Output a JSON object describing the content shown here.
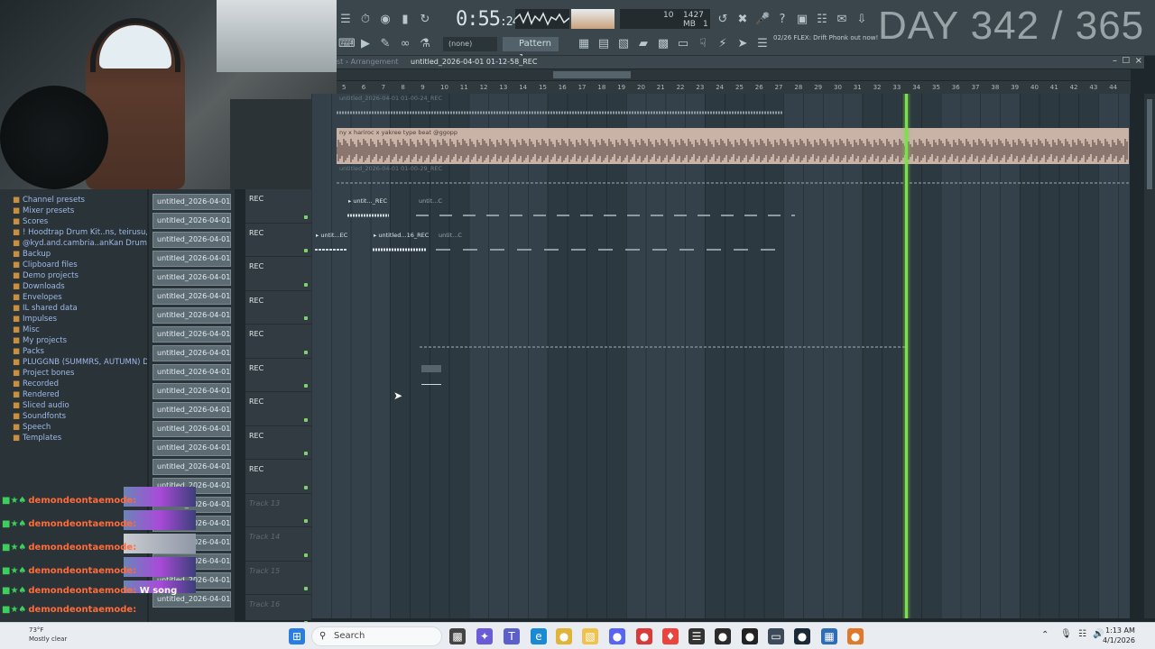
{
  "overlay": {
    "day_counter": "DAY 342 / 365"
  },
  "toolbar": {
    "time_main": "0:55",
    "time_sub": ":24",
    "cpu_value": "10",
    "memory": "1427 MB",
    "cpu_sub": "1",
    "pattern_label": "Pattern 1",
    "none_label": "(none)",
    "hint_date": "02/26",
    "hint_text": "FLEX: Drift Phonk out now!"
  },
  "playlist": {
    "title_prefix": "st › Arrangement",
    "title": "untitled_2026-04-01 01-12-58_REC",
    "ruler": [
      "5",
      "6",
      "7",
      "8",
      "9",
      "10",
      "11",
      "12",
      "13",
      "14",
      "15",
      "16",
      "17",
      "18",
      "19",
      "20",
      "21",
      "22",
      "23",
      "24",
      "25",
      "26",
      "27",
      "28",
      "29",
      "30",
      "31",
      "32",
      "33",
      "34",
      "35",
      "36",
      "37",
      "38",
      "39",
      "40",
      "41",
      "42",
      "43",
      "44"
    ],
    "clips": {
      "row1_title": "untitled_2026-04-01 01-00-24_REC",
      "beat_title": "ny x hariroc x yakree type beat @ggopp",
      "row3_title": "untitled_2026-04-01 01-00-29_REC",
      "r4_a": "▸ untit..._REC",
      "r4_b": "untit...C",
      "r5_a": "▸ untit...EC",
      "r5_b": "▸ untitled...16_REC",
      "r5_c": "untit...C"
    }
  },
  "tracks": [
    {
      "label": "REC"
    },
    {
      "label": "REC"
    },
    {
      "label": "REC"
    },
    {
      "label": "REC"
    },
    {
      "label": "REC"
    },
    {
      "label": "REC"
    },
    {
      "label": "REC"
    },
    {
      "label": "REC"
    },
    {
      "label": "REC"
    },
    {
      "label": "Track 13"
    },
    {
      "label": "Track 14"
    },
    {
      "label": "Track 15"
    },
    {
      "label": "Track 16"
    }
  ],
  "browser": {
    "items": [
      {
        "label": "Channel presets"
      },
      {
        "label": "Mixer presets"
      },
      {
        "label": "Scores"
      },
      {
        "label": "! Hoodtrap Drum Kit..ns, teirusu, jai) (2)"
      },
      {
        "label": "@kyd.and.cambria..anKan DrumsLoopKit"
      },
      {
        "label": "Backup"
      },
      {
        "label": "Clipboard files"
      },
      {
        "label": "Demo projects"
      },
      {
        "label": "Downloads"
      },
      {
        "label": "Envelopes"
      },
      {
        "label": "IL shared data"
      },
      {
        "label": "Impulses"
      },
      {
        "label": "Misc"
      },
      {
        "label": "My projects"
      },
      {
        "label": "Packs"
      },
      {
        "label": "PLUGGNB (SUMMRS, AUTUMN) DRUMKIT"
      },
      {
        "label": "Project bones"
      },
      {
        "label": "Recorded"
      },
      {
        "label": "Rendered"
      },
      {
        "label": "Sliced audio"
      },
      {
        "label": "Soundfonts"
      },
      {
        "label": "Speech"
      },
      {
        "label": "Templates"
      }
    ]
  },
  "channels": [
    "untitled_2026-04-01 00-",
    "untitled_2026-04-01 00-",
    "untitled_2026-04-01 00-",
    "untitled_2026-04-01 00-",
    "untitled_2026-04-01 00-",
    "untitled_2026-04-01 00-",
    "untitled_2026-04-01 00-",
    "untitled_2026-04-01 00-",
    "untitled_2026-04-01 00-",
    "untitled_2026-04-01 00-",
    "untitled_2026-04-01 00-",
    "untitled_2026-04-01 00-",
    "untitled_2026-04-01 00-",
    "untitled_2026-04-01 00-",
    "untitled_2026-04-01 00-",
    "untitled_2026-04-01 00-",
    "untitled_2026-04-01 00-",
    "untitled_2026-04-01 00-",
    "untitled_2026-04-01 00-",
    "untitled_2026-04-01 00-",
    "untitled_2026-04-01 00-",
    "untitled_2026-04-01 00-"
  ],
  "chat": {
    "user": "demondeontaemode:",
    "msg": "W song"
  },
  "taskbar": {
    "search": "Search",
    "time": "1:13 AM",
    "date": "4/1/2026",
    "weather_temp": "73°F",
    "weather_desc": "Mostly clear"
  },
  "colors": {
    "playhead": "#7be049",
    "grid": "#34414a",
    "clip_beat": "#c9b2a6"
  }
}
